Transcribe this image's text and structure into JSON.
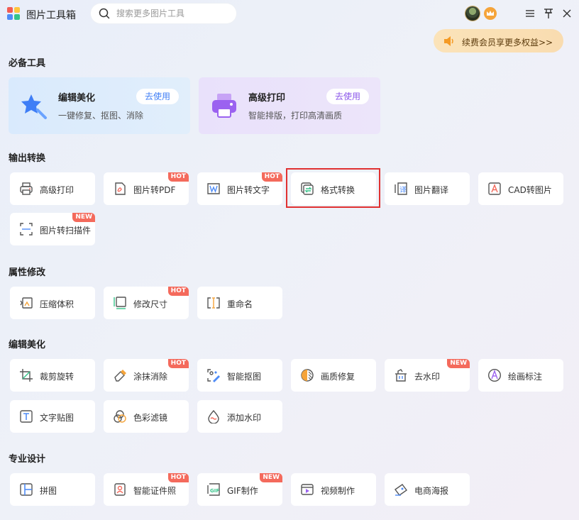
{
  "app": {
    "title": "图片工具箱"
  },
  "search": {
    "placeholder": "搜索更多图片工具"
  },
  "promo": {
    "label": "续费会员享更多权益>>"
  },
  "sections": {
    "essential": {
      "title": "必备工具",
      "cards": [
        {
          "title": "编辑美化",
          "desc": "一键修复、抠图、消除",
          "action": "去使用",
          "icon": "star-wand-icon"
        },
        {
          "title": "高级打印",
          "desc": "智能排版，打印高清画质",
          "action": "去使用",
          "icon": "printer-icon"
        }
      ]
    },
    "convert": {
      "title": "输出转换",
      "tools": [
        {
          "label": "高级打印",
          "icon": "printer-icon",
          "tag": ""
        },
        {
          "label": "图片转PDF",
          "icon": "pdf-icon",
          "tag": "HOT"
        },
        {
          "label": "图片转文字",
          "icon": "word-icon",
          "tag": "HOT"
        },
        {
          "label": "格式转换",
          "icon": "format-convert-icon",
          "tag": "",
          "highlighted": true
        },
        {
          "label": "图片翻译",
          "icon": "translate-icon",
          "tag": ""
        },
        {
          "label": "CAD转图片",
          "icon": "cad-icon",
          "tag": ""
        },
        {
          "label": "图片转扫描件",
          "icon": "scan-icon",
          "tag": "NEW"
        }
      ]
    },
    "attribute": {
      "title": "属性修改",
      "tools": [
        {
          "label": "压缩体积",
          "icon": "compress-icon",
          "tag": ""
        },
        {
          "label": "修改尺寸",
          "icon": "resize-icon",
          "tag": "HOT"
        },
        {
          "label": "重命名",
          "icon": "rename-icon",
          "tag": ""
        }
      ]
    },
    "edit": {
      "title": "编辑美化",
      "tools": [
        {
          "label": "裁剪旋转",
          "icon": "crop-icon",
          "tag": ""
        },
        {
          "label": "涂抹消除",
          "icon": "eraser-icon",
          "tag": "HOT"
        },
        {
          "label": "智能抠图",
          "icon": "cutout-icon",
          "tag": ""
        },
        {
          "label": "画质修复",
          "icon": "quality-icon",
          "tag": ""
        },
        {
          "label": "去水印",
          "icon": "watermark-remove-icon",
          "tag": "NEW"
        },
        {
          "label": "绘画标注",
          "icon": "annotate-icon",
          "tag": ""
        },
        {
          "label": "文字贴图",
          "icon": "text-icon",
          "tag": ""
        },
        {
          "label": "色彩滤镜",
          "icon": "filter-icon",
          "tag": ""
        },
        {
          "label": "添加水印",
          "icon": "watermark-add-icon",
          "tag": ""
        }
      ]
    },
    "design": {
      "title": "专业设计",
      "tools": [
        {
          "label": "拼图",
          "icon": "collage-icon",
          "tag": ""
        },
        {
          "label": "智能证件照",
          "icon": "id-photo-icon",
          "tag": "HOT"
        },
        {
          "label": "GIF制作",
          "icon": "gif-icon",
          "tag": "NEW"
        },
        {
          "label": "视频制作",
          "icon": "video-icon",
          "tag": ""
        },
        {
          "label": "电商海报",
          "icon": "poster-icon",
          "tag": ""
        }
      ]
    }
  },
  "colors": {
    "accent": "#5b7cf0",
    "hot_tag": "#f46a5c",
    "highlight_border": "#e03131",
    "promo_text": "#5b3a0c"
  }
}
